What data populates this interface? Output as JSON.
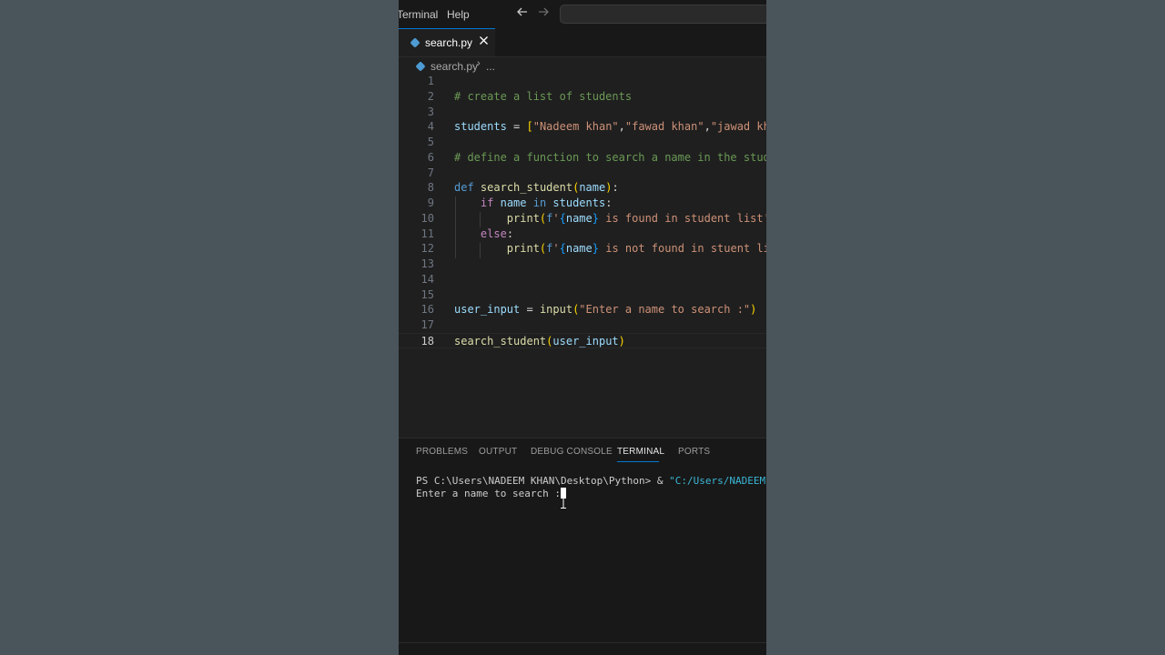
{
  "menu": {
    "terminal": "Terminal",
    "help": "Help"
  },
  "nav": {
    "back_icon": "arrow-left-icon",
    "forward_icon": "arrow-right-icon"
  },
  "tab": {
    "filename": "search.py",
    "close_icon": "close-icon"
  },
  "breadcrumb": {
    "file": "search.py",
    "separator": "›",
    "more": "..."
  },
  "editor": {
    "active_line": 18,
    "lines": [
      {
        "num": "1",
        "tokens": []
      },
      {
        "num": "2",
        "tokens": [
          {
            "t": "# create a list of students",
            "c": "t-cmt"
          }
        ]
      },
      {
        "num": "3",
        "tokens": []
      },
      {
        "num": "4",
        "tokens": [
          {
            "t": "students",
            "c": "t-var"
          },
          {
            "t": " = ",
            "c": "t-op"
          },
          {
            "t": "[",
            "c": "t-br1"
          },
          {
            "t": "\"Nadeem khan\"",
            "c": "t-str"
          },
          {
            "t": ",",
            "c": "t-op"
          },
          {
            "t": "\"fawad khan\"",
            "c": "t-str"
          },
          {
            "t": ",",
            "c": "t-op"
          },
          {
            "t": "\"jawad khan\"",
            "c": "t-str"
          }
        ]
      },
      {
        "num": "5",
        "tokens": []
      },
      {
        "num": "6",
        "tokens": [
          {
            "t": "# define a function to search a name in the student",
            "c": "t-cmt"
          }
        ]
      },
      {
        "num": "7",
        "tokens": []
      },
      {
        "num": "8",
        "tokens": [
          {
            "t": "def",
            "c": "t-kw"
          },
          {
            "t": " ",
            "c": "t-op"
          },
          {
            "t": "search_student",
            "c": "t-fn"
          },
          {
            "t": "(",
            "c": "t-br1"
          },
          {
            "t": "name",
            "c": "t-var"
          },
          {
            "t": ")",
            "c": "t-br1"
          },
          {
            "t": ":",
            "c": "t-op"
          }
        ]
      },
      {
        "num": "9",
        "tokens": [
          {
            "t": "    ",
            "c": "t-op"
          },
          {
            "t": "if",
            "c": "t-ctl"
          },
          {
            "t": " ",
            "c": "t-op"
          },
          {
            "t": "name",
            "c": "t-var"
          },
          {
            "t": " in ",
            "c": "t-kw"
          },
          {
            "t": "students",
            "c": "t-var"
          },
          {
            "t": ":",
            "c": "t-op"
          }
        ]
      },
      {
        "num": "10",
        "tokens": [
          {
            "t": "        ",
            "c": "t-op"
          },
          {
            "t": "print",
            "c": "t-fn"
          },
          {
            "t": "(",
            "c": "t-br1"
          },
          {
            "t": "f",
            "c": "t-kw"
          },
          {
            "t": "'",
            "c": "t-str"
          },
          {
            "t": "{",
            "c": "t-br3"
          },
          {
            "t": "name",
            "c": "t-var"
          },
          {
            "t": "}",
            "c": "t-br3"
          },
          {
            "t": " is found in student list'",
            "c": "t-str"
          },
          {
            "t": ")",
            "c": "t-br1"
          }
        ]
      },
      {
        "num": "11",
        "tokens": [
          {
            "t": "    ",
            "c": "t-op"
          },
          {
            "t": "else",
            "c": "t-ctl"
          },
          {
            "t": ":",
            "c": "t-op"
          }
        ]
      },
      {
        "num": "12",
        "tokens": [
          {
            "t": "        ",
            "c": "t-op"
          },
          {
            "t": "print",
            "c": "t-fn"
          },
          {
            "t": "(",
            "c": "t-br1"
          },
          {
            "t": "f",
            "c": "t-kw"
          },
          {
            "t": "'",
            "c": "t-str"
          },
          {
            "t": "{",
            "c": "t-br3"
          },
          {
            "t": "name",
            "c": "t-var"
          },
          {
            "t": "}",
            "c": "t-br3"
          },
          {
            "t": " is not found in stuent list.",
            "c": "t-str"
          }
        ]
      },
      {
        "num": "13",
        "tokens": []
      },
      {
        "num": "14",
        "tokens": []
      },
      {
        "num": "15",
        "tokens": []
      },
      {
        "num": "16",
        "tokens": [
          {
            "t": "user_input",
            "c": "t-var"
          },
          {
            "t": " = ",
            "c": "t-op"
          },
          {
            "t": "input",
            "c": "t-fn"
          },
          {
            "t": "(",
            "c": "t-br1"
          },
          {
            "t": "\"Enter a name to search :\"",
            "c": "t-str"
          },
          {
            "t": ")",
            "c": "t-br1"
          }
        ]
      },
      {
        "num": "17",
        "tokens": []
      },
      {
        "num": "18",
        "tokens": [
          {
            "t": "search_student",
            "c": "t-fn"
          },
          {
            "t": "(",
            "c": "t-br1"
          },
          {
            "t": "user_input",
            "c": "t-var"
          },
          {
            "t": ")",
            "c": "t-br1"
          }
        ]
      }
    ]
  },
  "panel": {
    "tabs": [
      "PROBLEMS",
      "OUTPUT",
      "DEBUG CONSOLE",
      "TERMINAL",
      "PORTS"
    ],
    "active_tab": "TERMINAL",
    "terminal": {
      "prompt": "PS C:\\Users\\NADEEM KHAN\\Desktop\\Python> & ",
      "command_path": "\"C:/Users/NADEEM KH",
      "output": "Enter a name to search :"
    }
  },
  "colors": {
    "accent": "#0078d4",
    "editor_bg": "#1f1f1f",
    "chrome_bg": "#181818"
  }
}
